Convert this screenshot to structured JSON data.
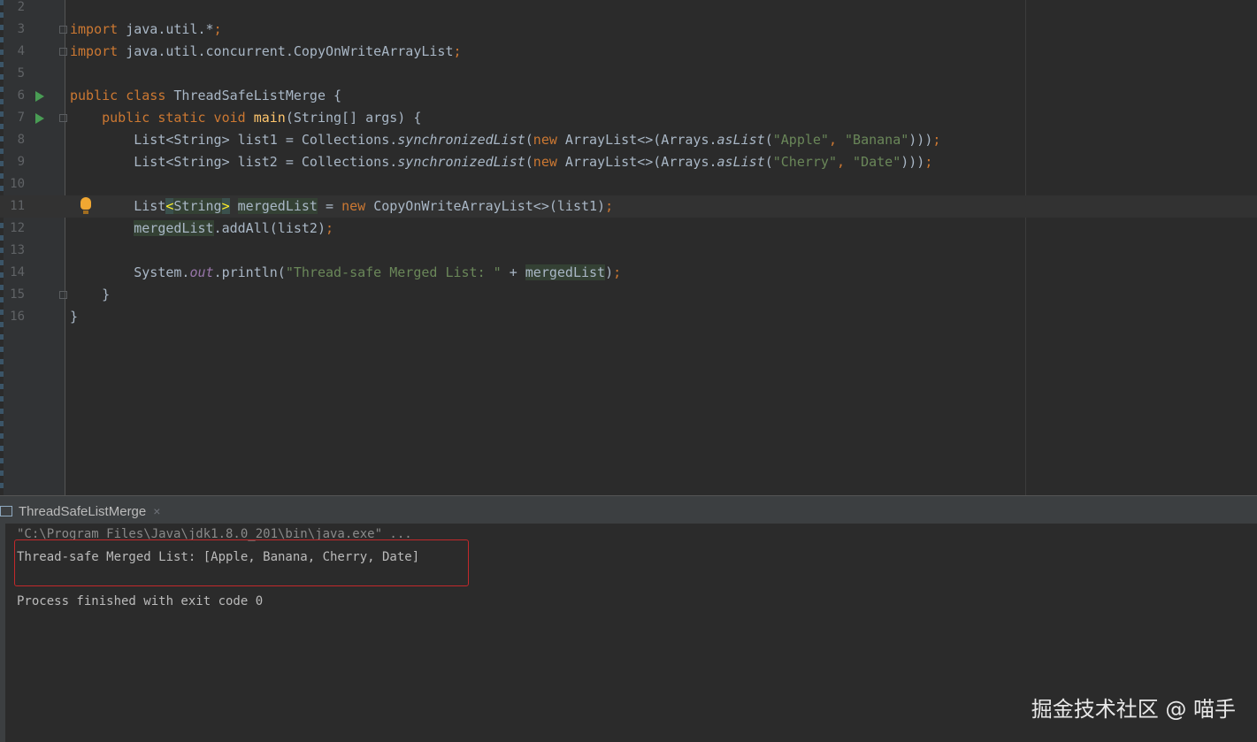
{
  "editor": {
    "lines": [
      {
        "num": "2",
        "segments": []
      },
      {
        "num": "3",
        "segments": [
          {
            "t": "import",
            "c": "kw"
          },
          {
            "t": " java.util.*",
            "c": ""
          },
          {
            "t": ";",
            "c": "kw"
          }
        ]
      },
      {
        "num": "4",
        "segments": [
          {
            "t": "import",
            "c": "kw"
          },
          {
            "t": " java.util.concurrent.CopyOnWriteArrayList",
            "c": ""
          },
          {
            "t": ";",
            "c": "kw"
          }
        ]
      },
      {
        "num": "5",
        "segments": []
      },
      {
        "num": "6",
        "segments": [
          {
            "t": "public class ",
            "c": "kw"
          },
          {
            "t": "ThreadSafeListMerge {",
            "c": ""
          }
        ]
      },
      {
        "num": "7",
        "segments": [
          {
            "t": "    public static void ",
            "c": "kw"
          },
          {
            "t": "main",
            "c": "fn"
          },
          {
            "t": "(String[] args) {",
            "c": ""
          }
        ]
      },
      {
        "num": "8",
        "segments": [
          {
            "t": "        List<String> list1 = Collections.",
            "c": ""
          },
          {
            "t": "synchronizedList",
            "c": "it"
          },
          {
            "t": "(",
            "c": ""
          },
          {
            "t": "new ",
            "c": "kw"
          },
          {
            "t": "ArrayList<>(Arrays.",
            "c": ""
          },
          {
            "t": "asList",
            "c": "it"
          },
          {
            "t": "(",
            "c": ""
          },
          {
            "t": "\"Apple\"",
            "c": "str"
          },
          {
            "t": ", ",
            "c": "kw"
          },
          {
            "t": "\"Banana\"",
            "c": "str"
          },
          {
            "t": ")))",
            "c": ""
          },
          {
            "t": ";",
            "c": "kw"
          }
        ]
      },
      {
        "num": "9",
        "segments": [
          {
            "t": "        List<String> list2 = Collections.",
            "c": ""
          },
          {
            "t": "synchronizedList",
            "c": "it"
          },
          {
            "t": "(",
            "c": ""
          },
          {
            "t": "new ",
            "c": "kw"
          },
          {
            "t": "ArrayList<>(Arrays.",
            "c": ""
          },
          {
            "t": "asList",
            "c": "it"
          },
          {
            "t": "(",
            "c": ""
          },
          {
            "t": "\"Cherry\"",
            "c": "str"
          },
          {
            "t": ", ",
            "c": "kw"
          },
          {
            "t": "\"Date\"",
            "c": "str"
          },
          {
            "t": ")))",
            "c": ""
          },
          {
            "t": ";",
            "c": "kw"
          }
        ]
      },
      {
        "num": "10",
        "segments": []
      },
      {
        "num": "11",
        "segments": [
          {
            "t": "        List",
            "c": ""
          },
          {
            "t": "<",
            "c": "brace-hl"
          },
          {
            "t": "String",
            "c": "hl"
          },
          {
            "t": ">",
            "c": "brace-hl"
          },
          {
            "t": " ",
            "c": ""
          },
          {
            "t": "mergedList",
            "c": "hl"
          },
          {
            "t": " = ",
            "c": ""
          },
          {
            "t": "new ",
            "c": "kw"
          },
          {
            "t": "CopyOnWriteArrayList<>(list1)",
            "c": ""
          },
          {
            "t": ";",
            "c": "kw"
          }
        ]
      },
      {
        "num": "12",
        "segments": [
          {
            "t": "        ",
            "c": ""
          },
          {
            "t": "mergedList",
            "c": "hl"
          },
          {
            "t": ".addAll(list2)",
            "c": ""
          },
          {
            "t": ";",
            "c": "kw"
          }
        ]
      },
      {
        "num": "13",
        "segments": []
      },
      {
        "num": "14",
        "segments": [
          {
            "t": "        System.",
            "c": ""
          },
          {
            "t": "out",
            "c": "fld"
          },
          {
            "t": ".println(",
            "c": ""
          },
          {
            "t": "\"Thread-safe Merged List: \"",
            "c": "str"
          },
          {
            "t": " + ",
            "c": ""
          },
          {
            "t": "mergedList",
            "c": "hl"
          },
          {
            "t": ")",
            "c": ""
          },
          {
            "t": ";",
            "c": "kw"
          }
        ]
      },
      {
        "num": "15",
        "segments": [
          {
            "t": "    }",
            "c": ""
          }
        ]
      },
      {
        "num": "16",
        "segments": [
          {
            "t": "}",
            "c": ""
          }
        ]
      }
    ]
  },
  "console": {
    "tab_label": "ThreadSafeListMerge",
    "tab_close": "×",
    "command_line": "\"C:\\Program Files\\Java\\jdk1.8.0_201\\bin\\java.exe\" ...",
    "output_line": "Thread-safe Merged List: [Apple, Banana, Cherry, Date]",
    "exit_line": "Process finished with exit code 0"
  },
  "watermark": "掘金技术社区 @ 喵手",
  "icons": {
    "run": "run-icon",
    "fold": "fold-icon",
    "bulb": "intention-bulb-icon",
    "console_tab": "console-tab-icon"
  }
}
